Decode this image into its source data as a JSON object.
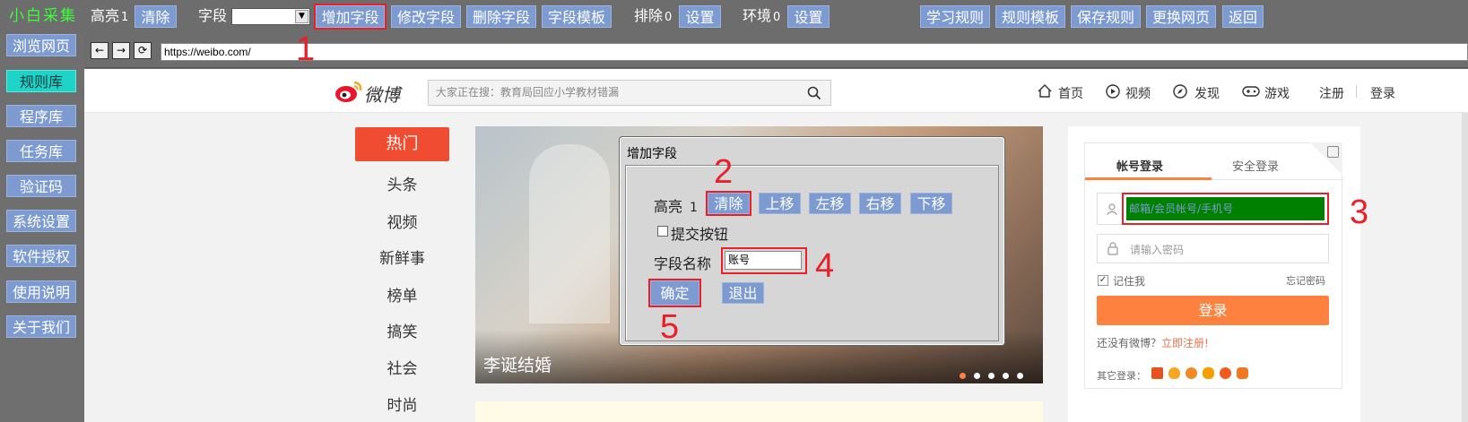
{
  "app": {
    "brand": "小白采集",
    "highlight_label": "高亮",
    "highlight_count": "1",
    "clear_btn": "清除",
    "field_label": "字段",
    "add_field_btn": "增加字段",
    "edit_field_btn": "修改字段",
    "delete_field_btn": "删除字段",
    "field_template_btn": "字段模板",
    "exclude_label": "排除",
    "exclude_count": "0",
    "exclude_settings_btn": "设置",
    "env_label": "环境",
    "env_count": "0",
    "env_settings_btn": "设置",
    "learn_rules_btn": "学习规则",
    "rule_template_btn": "规则模板",
    "save_rule_btn": "保存规则",
    "change_page_btn": "更换网页",
    "back_btn": "返回"
  },
  "sidebar": {
    "items": [
      {
        "label": "浏览网页"
      },
      {
        "label": "规则库"
      },
      {
        "label": "程序库"
      },
      {
        "label": "任务库"
      },
      {
        "label": "验证码"
      },
      {
        "label": "系统设置"
      },
      {
        "label": "软件授权"
      },
      {
        "label": "使用说明"
      },
      {
        "label": "关于我们"
      }
    ]
  },
  "browser": {
    "back_icon": "←",
    "forward_icon": "→",
    "refresh_icon": "⟳",
    "url": "https://weibo.com/"
  },
  "weibo": {
    "logo_text": "微博",
    "search_placeholder": "大家正在搜：教育局回应小学教材错漏",
    "nav": [
      "首页",
      "视频",
      "发现",
      "游戏",
      "注册",
      "登录"
    ],
    "left_nav": [
      "热门",
      "头条",
      "视频",
      "新鲜事",
      "榜单",
      "搞笑",
      "社会",
      "时尚"
    ],
    "banner_caption": "李诞结婚",
    "login_tabs": [
      "帐号登录",
      "安全登录"
    ],
    "account_placeholder": "邮箱/会员帐号/手机号",
    "password_placeholder": "请输入密码",
    "remember_me": "记住我",
    "forgot_password": "忘记密码",
    "login_btn": "登录",
    "no_account": "还没有微博？",
    "register_now": "立即注册!",
    "other_login": "其它登录："
  },
  "dialog": {
    "title": "增加字段",
    "highlight_label": "高亮",
    "highlight_count": "1",
    "clear_btn": "清除",
    "up_btn": "上移",
    "left_btn": "左移",
    "right_btn": "右移",
    "down_btn": "下移",
    "submit_checkbox_label": "提交按钮",
    "field_name_label": "字段名称",
    "field_name_value": "账号",
    "ok_btn": "确定",
    "exit_btn": "退出"
  },
  "annotations": [
    "1",
    "2",
    "3",
    "4",
    "5"
  ],
  "colors": {
    "button": "#7d9bd0",
    "active_sidebar": "#1ed4c8",
    "marker": "#e8202a",
    "weibo_orange": "#ff8140",
    "highlight_green": "#008000"
  }
}
